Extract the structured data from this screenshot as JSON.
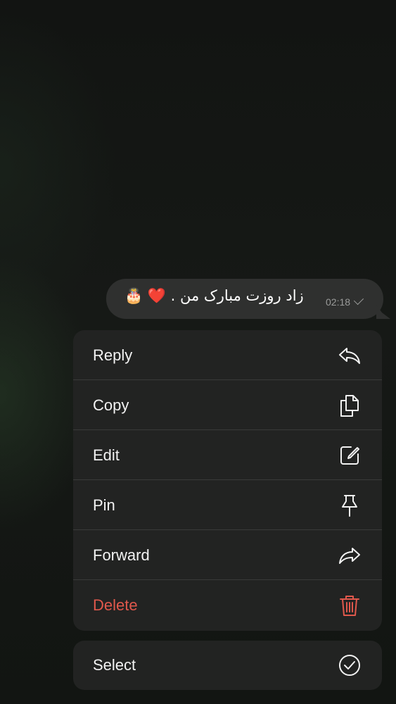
{
  "message": {
    "text": "زاد روزت مبارک من . ❤️ 🎂",
    "time": "02:18",
    "status": "sent-check"
  },
  "menu": {
    "items": [
      {
        "label": "Reply",
        "icon": "reply-icon"
      },
      {
        "label": "Copy",
        "icon": "copy-icon"
      },
      {
        "label": "Edit",
        "icon": "edit-icon"
      },
      {
        "label": "Pin",
        "icon": "pin-icon"
      },
      {
        "label": "Forward",
        "icon": "forward-icon"
      },
      {
        "label": "Delete",
        "icon": "trash-icon"
      }
    ],
    "select": {
      "label": "Select",
      "icon": "check-circle-icon"
    }
  },
  "colors": {
    "background": "#141614",
    "bubble": "#2f302f",
    "menu": "#222322",
    "text": "#f2f2f2",
    "danger": "#e0584c",
    "meta": "#9a9b9a"
  }
}
